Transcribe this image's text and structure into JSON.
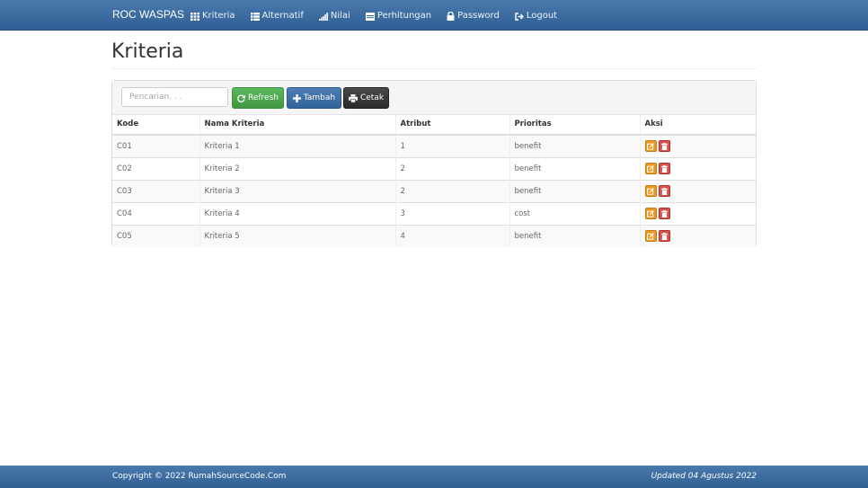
{
  "navbar": {
    "brand": "ROC WASPAS",
    "items": [
      {
        "label": "Kriteria",
        "icon": "grid-icon"
      },
      {
        "label": "Alternatif",
        "icon": "list-icon"
      },
      {
        "label": "Nilai",
        "icon": "signal-icon"
      },
      {
        "label": "Perhitungan",
        "icon": "calendar-icon"
      },
      {
        "label": "Password",
        "icon": "lock-icon"
      },
      {
        "label": "Logout",
        "icon": "logout-icon"
      }
    ]
  },
  "page": {
    "title": "Kriteria"
  },
  "toolbar": {
    "search_placeholder": "Pencarian. . .",
    "refresh_label": "Refresh",
    "tambah_label": "Tambah",
    "cetak_label": "Cetak"
  },
  "table": {
    "headers": [
      "Kode",
      "Nama Kriteria",
      "Atribut",
      "Prioritas",
      "Aksi"
    ],
    "rows": [
      {
        "kode": "C01",
        "nama": "Kriteria 1",
        "atribut": "1",
        "prioritas": "benefit"
      },
      {
        "kode": "C02",
        "nama": "Kriteria 2",
        "atribut": "2",
        "prioritas": "benefit"
      },
      {
        "kode": "C03",
        "nama": "Kriteria 3",
        "atribut": "2",
        "prioritas": "benefit"
      },
      {
        "kode": "C04",
        "nama": "Kriteria 4",
        "atribut": "3",
        "prioritas": "cost"
      },
      {
        "kode": "C05",
        "nama": "Kriteria 5",
        "atribut": "4",
        "prioritas": "benefit"
      }
    ]
  },
  "footer": {
    "copyright": "Copyright © 2022 RumahSourceCode.Com",
    "updated": "Updated 04 Agustus 2022"
  },
  "colors": {
    "navbar": "#3a6ba1",
    "refresh": "#4cae4c",
    "tambah": "#3b6fa6",
    "cetak": "#333333",
    "edit": "#ec971f",
    "delete": "#d9534f"
  }
}
